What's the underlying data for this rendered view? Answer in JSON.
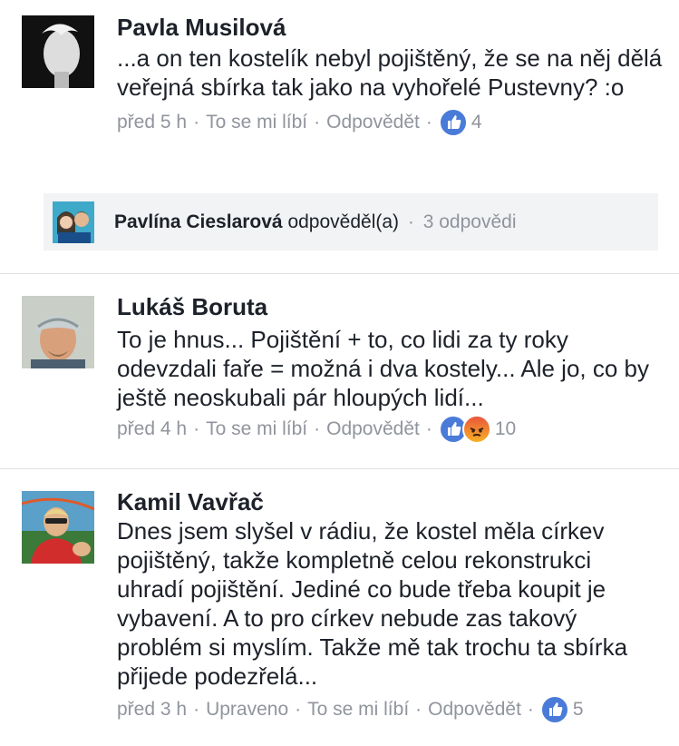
{
  "comments": [
    {
      "author": "Pavla Musilová",
      "text": "...a on ten kostelík nebyl pojištěný, že se na něj dělá veřejná sbírka tak jako na vyhořelé Pustevny? :o",
      "time": "před 5 h",
      "like": "To se mi líbí",
      "reply": "Odpovědět",
      "reactions": [
        "like-icon"
      ],
      "reaction_count": "4"
    },
    {
      "author": "Lukáš Boruta",
      "text": "To je hnus... Pojištění + to, co lidi za ty roky odevzdali faře = možná i dva kostely... Ale jo, co by ještě neoskubali pár hloupých lidí...",
      "time": "před 4 h",
      "like": "To se mi líbí",
      "reply": "Odpovědět",
      "reactions": [
        "like-icon",
        "angry-icon"
      ],
      "reaction_count": "10"
    },
    {
      "author": "Kamil Vavřač",
      "text": "Dnes jsem slyšel v rádiu, že kostel měla církev pojištěný, takže kompletně celou rekonstrukci uhradí pojištění. Jediné co bude třeba koupit je vybavení. A to pro církev  nebude zas takový problém si myslím. Takže mě tak trochu ta sbírka přijede podezřelá...",
      "time": "před 3 h",
      "edited": "Upraveno",
      "like": "To se mi líbí",
      "reply": "Odpovědět",
      "reactions": [
        "like-icon"
      ],
      "reaction_count": "5"
    }
  ],
  "reply_summary": {
    "name": "Pavlína Cieslarová",
    "action": "odpověděl(a)",
    "count": "3 odpovědi"
  },
  "separator": "·",
  "colors": {
    "text": "#1d2129",
    "meta": "#90949c",
    "like": "#4a7bd8",
    "reply_bg": "#f2f3f5",
    "divider": "#dddfe2"
  }
}
